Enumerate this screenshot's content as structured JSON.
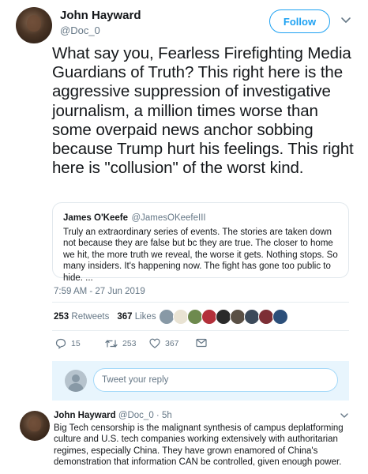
{
  "tweet": {
    "author_name": "John Hayward",
    "author_handle": "@Doc_0",
    "follow_label": "Follow",
    "text": "What say you, Fearless Firefighting Media Guardians of Truth? This right here is the aggressive suppression of investigative journalism, a million times worse than some overpaid news anchor sobbing because Trump hurt his feelings. This right here is \"collusion\" of the worst kind.",
    "timestamp": "7:59 AM - 27 Jun 2019"
  },
  "quoted": {
    "name": "James O'Keefe",
    "handle": "@JamesOKeefeIII",
    "text": "Truly an extraordinary series of events. The stories are taken down not because they are false but bc they are true. The closer to home we hit, the more truth we reveal, the worse it gets. Nothing stops. So many insiders. It's happening now. The fight has gone too public to hide. ..."
  },
  "stats": {
    "retweets_count": "253",
    "retweets_label": "Retweets",
    "likes_count": "367",
    "likes_label": "Likes"
  },
  "actions": {
    "replies": "15",
    "retweets": "253",
    "likes": "367"
  },
  "reply_box": {
    "placeholder": "Tweet your reply"
  },
  "reply": {
    "author": "John Hayward",
    "handle_time": "@Doc_0 · 5h",
    "text": "Big Tech censorship is the malignant synthesis of campus deplatforming culture and U.S. tech companies working extensively with authoritarian regimes, especially China. They have grown enamored of China's demonstration that information CAN be controlled, given enough power."
  },
  "colors": {
    "accent": "#1da1f2",
    "secondary_text": "#657786",
    "reply_bg": "#e8f5fd"
  }
}
